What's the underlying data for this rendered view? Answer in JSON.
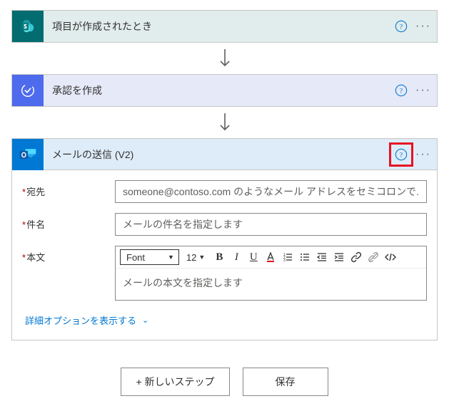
{
  "steps": {
    "sharepoint": {
      "title": "項目が作成されたとき"
    },
    "approvals": {
      "title": "承認を作成"
    },
    "outlook": {
      "title": "メールの送信 (V2)"
    }
  },
  "mail": {
    "to_label": "宛先",
    "to_placeholder": "someone@contoso.com のようなメール アドレスをセミコロンで...",
    "subject_label": "件名",
    "subject_placeholder": "メールの件名を指定します",
    "body_label": "本文",
    "body_placeholder": "メールの本文を指定します"
  },
  "rte": {
    "font_label": "Font",
    "font_size": "12"
  },
  "advanced_options_label": "詳細オプションを表示する",
  "footer": {
    "new_step": "+ 新しいステップ",
    "save": "保存"
  }
}
